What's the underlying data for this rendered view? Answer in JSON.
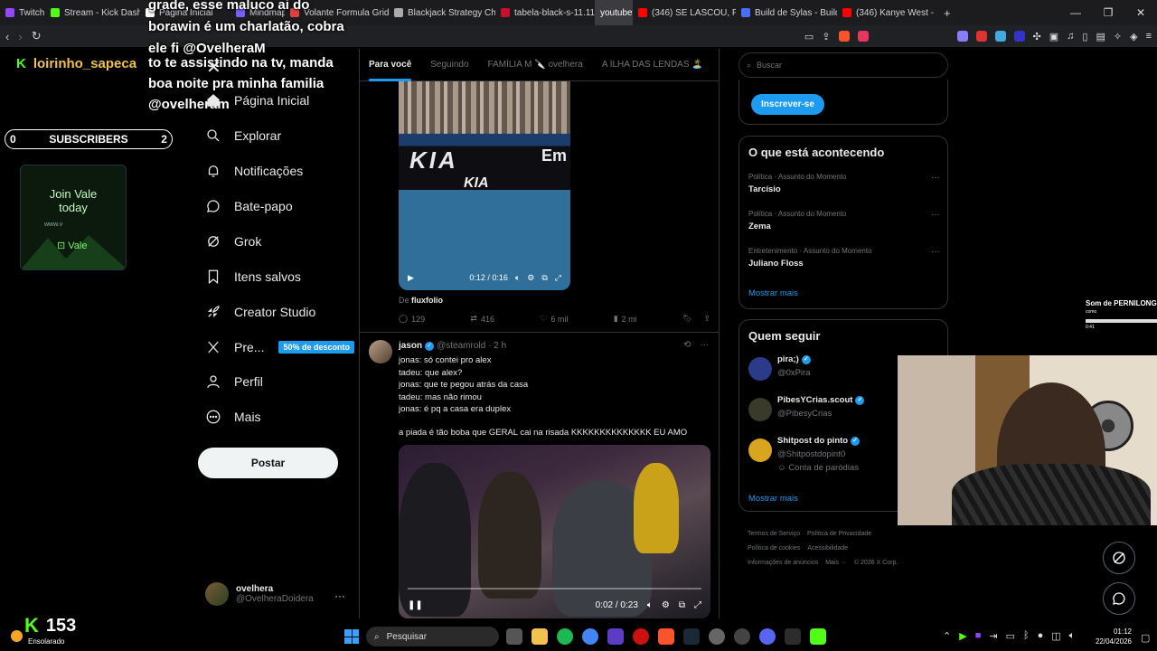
{
  "browser": {
    "tabs": [
      {
        "label": "Twitch",
        "color": "#9146ff"
      },
      {
        "label": "Stream - Kick Dashb",
        "color": "#53fc18"
      },
      {
        "label": "Página Inicial",
        "color": "#ffffff"
      },
      {
        "label": "Mindmap",
        "color": "#7b5cff"
      },
      {
        "label": "Volante Formula Grid",
        "color": "#e04040"
      },
      {
        "label": "Blackjack Strategy Ch",
        "color": "#aaaaaa"
      },
      {
        "label": "tabela-black-s-11.11",
        "color": "#c8102e"
      },
      {
        "label": "youtube",
        "color": "#3b3b40"
      },
      {
        "label": "(346) SE LASCOU, PO",
        "color": "#ff0000"
      },
      {
        "label": "Build de Sylas - Build",
        "color": "#4a6cf7"
      },
      {
        "label": "(346) Kanye West - R",
        "color": "#ff0000"
      }
    ],
    "active_tab": "youtube"
  },
  "overlay": {
    "chat_user": "loirinho_sapeca",
    "chat_message_top": "grade, esse maluco ai do borawin é um charlatão, cobra ele fi @OvelheraM",
    "chat_message": "to te assistindo na tv, manda boa noite pra minha familia @ovelheram",
    "subscribers_label": "SUBSCRIBERS",
    "subscribers_left": "0",
    "subscribers_right": "2",
    "vale_ad": {
      "title": "Join Vale today",
      "url": "www.v",
      "brand": "Vale"
    },
    "kick_count": "153",
    "weather": "Ensolarado",
    "now_playing": "Som de PERNILONG",
    "now_playing_sub": "como",
    "now_playing_time": "0:41"
  },
  "sidebar": {
    "items": [
      {
        "label": "Página Inicial",
        "icon": "home-icon"
      },
      {
        "label": "Explorar",
        "icon": "search-icon"
      },
      {
        "label": "Notificações",
        "icon": "bell-icon"
      },
      {
        "label": "Bate-papo",
        "icon": "chat-icon"
      },
      {
        "label": "Grok",
        "icon": "grok-icon"
      },
      {
        "label": "Itens salvos",
        "icon": "bookmark-icon"
      },
      {
        "label": "Creator Studio",
        "icon": "rocket-icon"
      },
      {
        "label": "Pre...",
        "icon": "x-logo-icon",
        "badge": "50% de desconto"
      },
      {
        "label": "Perfil",
        "icon": "person-icon"
      },
      {
        "label": "Mais",
        "icon": "more-circle-icon"
      }
    ],
    "post_label": "Postar",
    "account": {
      "name": "ovelhera",
      "handle": "@OvelheraDoidera"
    }
  },
  "feed": {
    "tabs": [
      "Para você",
      "Seguindo",
      "FAMÍLIA M 🔪 ovelhera",
      "A ILHA DAS LENDAS 🏝️"
    ],
    "post1": {
      "video_time": "0:12 / 0:16",
      "from_label": "De",
      "from": "fluxfolio",
      "replies": "129",
      "reposts": "416",
      "likes": "6 mil",
      "views": "2 mi",
      "video_text": {
        "kia": "KIA",
        "kia_small": "KIA",
        "banner": "Em"
      }
    },
    "post2": {
      "name": "jason",
      "handle": "@steamrold",
      "time": "· 2 h",
      "lines": [
        "jonas: só contei pro alex",
        "tadeu: que alex?",
        "jonas: que te pegou atrás da casa",
        "tadeu: mas não rimou",
        "jonas: é pq a casa era duplex"
      ],
      "text": "a piada é tão boba que GERAL cai na risada KKKKKKKKKKKKKK EU AMO",
      "video_time": "0:02 / 0:23"
    }
  },
  "right": {
    "search_placeholder": "Buscar",
    "subscribe_label": "Inscrever-se",
    "trends_title": "O que está acontecendo",
    "trends": [
      {
        "category": "Política · Assunto do Momento",
        "topic": "Tarcísio"
      },
      {
        "category": "Política · Assunto do Momento",
        "topic": "Zema"
      },
      {
        "category": "Entretenimento · Assunto do Momento",
        "topic": "Juliano Floss"
      }
    ],
    "show_more": "Mostrar mais",
    "follow_title": "Quem seguir",
    "follow": [
      {
        "name": "pira;)",
        "handle": "@0xPira",
        "avatar": "#2b3b8a"
      },
      {
        "name": "PibesYCrias.scout",
        "handle": "@PibesyCrias",
        "avatar": "#3a3a2a"
      },
      {
        "name": "Shitpost do pinto",
        "handle": "@Shitpostdopint0",
        "label": "Conta de paródias",
        "avatar": "#d9a520"
      }
    ],
    "footer": [
      "Termos de Serviço",
      "Política de Privacidade",
      "Política de cookies",
      "Acessibilidade",
      "Informações de anúncios",
      "Mais ···",
      "© 2026 X Corp."
    ]
  },
  "taskbar": {
    "search_placeholder": "Pesquisar",
    "time": "01:12",
    "date": "22/04/2026"
  },
  "colors": {
    "accent": "#1d9bf0",
    "kick_green": "#53fc18",
    "text": "#e7e9ea",
    "muted": "#71767b",
    "border": "#2f3336"
  }
}
